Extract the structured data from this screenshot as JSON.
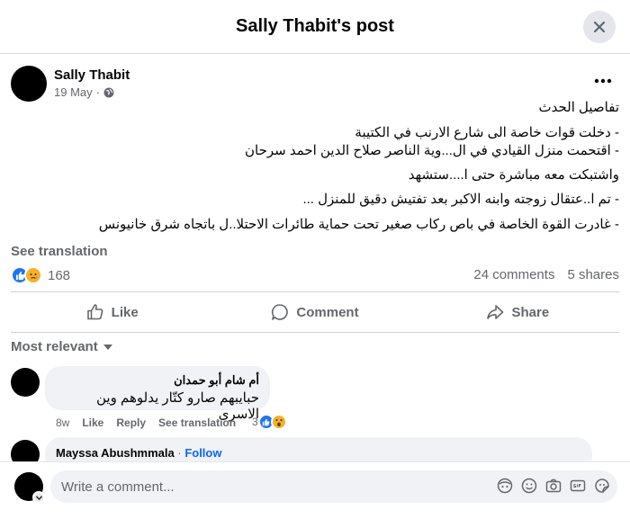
{
  "header": {
    "title": "Sally Thabit's post"
  },
  "post": {
    "author": "Sally Thabit",
    "date": "19 May",
    "date_separator": "·",
    "lines": [
      "تفاصيل الحدث",
      "- دخلت قوات خاصة الى شارع الارنب في الكتيبة",
      "- اقتحمت منزل القيادي في ال...وية الناصر صلاح الدين احمد سرحان",
      "واشتبكت معه مباشرة حتى ا....ستشهد",
      "- تم ا..عتقال زوجته وابنه الاكبر بعد تفتيش دقيق للمنزل ...",
      "- غادرت القوة الخاصة في باص ركاب صغير تحت حماية طائرات الاحتلا..ل باتجاه شرق خانيونس"
    ],
    "see_translation": "See translation",
    "reaction_count": "168",
    "comments_count": "24 comments",
    "shares_count": "5 shares"
  },
  "actions": {
    "like": "Like",
    "comment": "Comment",
    "share": "Share"
  },
  "comments_sort": "Most relevant",
  "comments": [
    {
      "name": "أم شام أبو حمدان",
      "text": "حبايبهم صارو كتّار يدلوهم وين الاسرى",
      "time": "8w",
      "like": "Like",
      "reply": "Reply",
      "see_translation": "See translation",
      "reaction_count": "3"
    },
    {
      "name": "Mayssa Abushmmala",
      "separator": " · ",
      "follow": "Follow"
    }
  ],
  "composer": {
    "placeholder": "Write a comment..."
  },
  "colors": {
    "accent": "#0866ff",
    "like_blue": "#1877f2",
    "sad_yellow": "#f7b125"
  }
}
